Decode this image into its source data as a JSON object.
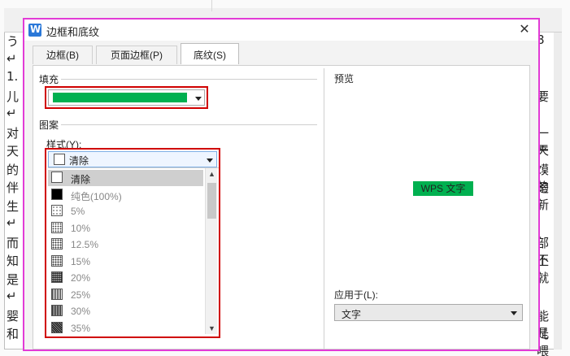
{
  "background_doc": {
    "left_chars": [
      "う",
      "↵",
      "1.",
      "儿",
      "↵",
      "对",
      "天",
      "的",
      "伴",
      "生",
      "↵",
      "而",
      "知",
      "是",
      "↵",
      "婴",
      "和"
    ],
    "right_chars": [
      "8",
      "",
      "",
      "要",
      "",
      "一天",
      "产",
      "馍的",
      "是新",
      "",
      "",
      "部不",
      "上就",
      "",
      "",
      "能是",
      "儿喂"
    ]
  },
  "dialog": {
    "title": "边框和底纹",
    "close_glyph": "✕",
    "tabs": [
      {
        "label": "边框(B)",
        "active": false
      },
      {
        "label": "页面边框(P)",
        "active": false
      },
      {
        "label": "底纹(S)",
        "active": true
      }
    ],
    "fill": {
      "group_label": "填充",
      "color": "#00b050"
    },
    "pattern": {
      "group_label": "图案",
      "style_label": "样式(Y):",
      "selected_value": "清除",
      "options": [
        {
          "label": "清除",
          "pattern": "none",
          "selected": true
        },
        {
          "label": "纯色(100%)",
          "pattern": "solid"
        },
        {
          "label": "5%",
          "pattern": "p5"
        },
        {
          "label": "10%",
          "pattern": "p10"
        },
        {
          "label": "12.5%",
          "pattern": "p12"
        },
        {
          "label": "15%",
          "pattern": "p15"
        },
        {
          "label": "20%",
          "pattern": "p20"
        },
        {
          "label": "25%",
          "pattern": "p25"
        },
        {
          "label": "30%",
          "pattern": "p30"
        },
        {
          "label": "35%",
          "pattern": "p35"
        }
      ]
    },
    "preview": {
      "label": "预览",
      "sample_text": "WPS 文字",
      "sample_bg": "#00b050"
    },
    "apply_to": {
      "label": "应用于(L):",
      "value": "文字"
    }
  },
  "colors": {
    "dialog_border": "#e23bd6",
    "highlight_border": "#d00000"
  }
}
